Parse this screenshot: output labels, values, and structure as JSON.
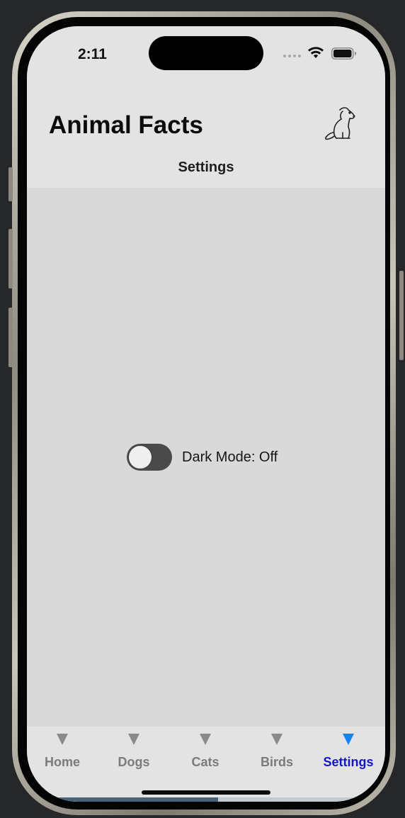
{
  "status_bar": {
    "time": "2:11",
    "icons": [
      "signal-dots-icon",
      "wifi-icon",
      "battery-icon"
    ]
  },
  "header": {
    "title": "Animal Facts",
    "logo_icon": "dog-icon",
    "subtitle": "Settings"
  },
  "settings": {
    "dark_mode_label": "Dark Mode: Off",
    "dark_mode_on": false
  },
  "tabs": [
    {
      "label": "Home",
      "active": false
    },
    {
      "label": "Dogs",
      "active": false
    },
    {
      "label": "Cats",
      "active": false
    },
    {
      "label": "Birds",
      "active": false
    },
    {
      "label": "Settings",
      "active": true
    }
  ],
  "colors": {
    "active_tab_text": "#1515c8",
    "active_tab_icon": "#1582f5",
    "inactive_tab": "#7b7b7b",
    "toggle_track": "#4a4a4b"
  }
}
